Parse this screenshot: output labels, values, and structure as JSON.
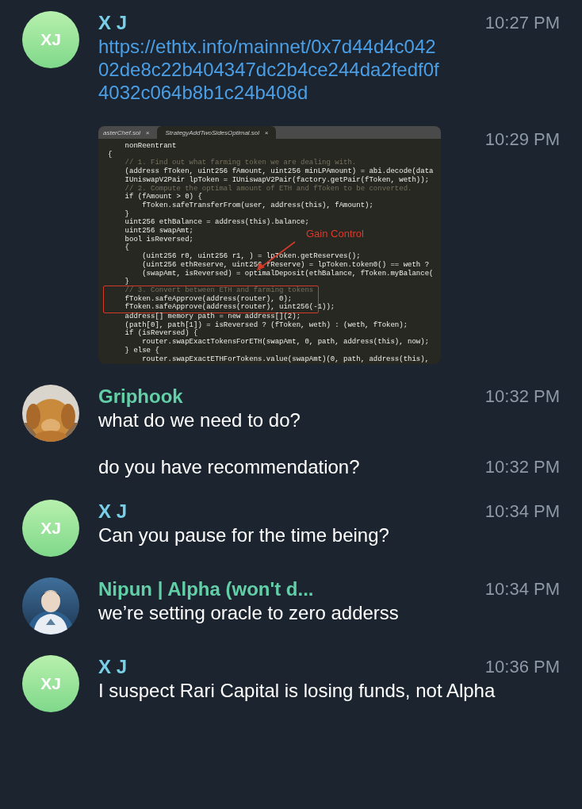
{
  "groups": [
    {
      "name": "X J",
      "color": "#78cfe6",
      "avatar": {
        "kind": "initials",
        "text": "XJ"
      },
      "messages": [
        {
          "kind": "link",
          "text": "https://ethtx.info/mainnet/0x7d44d4c04202de8c22b404347dc2b4ce244da2fedf0f4032c064b8b1c24b408d",
          "time": "10:27 PM"
        },
        {
          "time": "10:29 PM",
          "image": {
            "tabs": [
              {
                "label": "asterChef.sol",
                "close": "×",
                "selected": false
              },
              {
                "label": "StrategyAddTwoSidesOptimal.sol",
                "close": "×",
                "selected": true
              }
            ],
            "annotation": "Gain Control",
            "lines": [
              {
                "kind": "code",
                "text": "    nonReentrant",
                "highlighted": false
              },
              {
                "kind": "code",
                "text": "{",
                "highlighted": false
              },
              {
                "kind": "comment",
                "text": "    // 1. Find out what farming token we are dealing with.",
                "highlighted": false
              },
              {
                "kind": "code",
                "text": "    (address fToken, uint256 fAmount, uint256 minLPAmount) = abi.decode(data",
                "highlighted": false
              },
              {
                "kind": "code",
                "text": "    IUniswapV2Pair lpToken = IUniswapV2Pair(factory.getPair(fToken, weth));",
                "highlighted": false
              },
              {
                "kind": "comment",
                "text": "    // 2. Compute the optimal amount of ETH and fToken to be converted.",
                "highlighted": false
              },
              {
                "kind": "code",
                "text": "    if (fAmount > 0) {",
                "highlighted": false
              },
              {
                "kind": "code",
                "text": "        fToken.safeTransferFrom(user, address(this), fAmount);",
                "highlighted": false
              },
              {
                "kind": "code",
                "text": "    }",
                "highlighted": false
              },
              {
                "kind": "code",
                "text": "    uint256 ethBalance = address(this).balance;",
                "highlighted": false
              },
              {
                "kind": "code",
                "text": "    uint256 swapAmt;",
                "highlighted": false
              },
              {
                "kind": "code",
                "text": "    bool isReversed;",
                "highlighted": false
              },
              {
                "kind": "code",
                "text": "    {",
                "highlighted": false
              },
              {
                "kind": "code",
                "text": "        (uint256 r0, uint256 r1, ) = lpToken.getReserves();",
                "highlighted": false
              },
              {
                "kind": "code",
                "text": "        (uint256 ethReserve, uint256 fReserve) = lpToken.token0() == weth ?",
                "highlighted": false
              },
              {
                "kind": "code",
                "text": "        (swapAmt, isReversed) = optimalDeposit(ethBalance, fToken.myBalance(",
                "highlighted": false
              },
              {
                "kind": "code",
                "text": "    }",
                "highlighted": false
              },
              {
                "kind": "comment",
                "text": "    // 3. Convert between ETH and farming tokens",
                "highlighted": true
              },
              {
                "kind": "code",
                "text": "    fToken.safeApprove(address(router), 0);",
                "highlighted": true
              },
              {
                "kind": "code",
                "text": "    fToken.safeApprove(address(router), uint256(-1));",
                "highlighted": true
              },
              {
                "kind": "code",
                "text": "    address[] memory path = new address[](2);",
                "highlighted": false
              },
              {
                "kind": "code",
                "text": "    (path[0], path[1]) = isReversed ? (fToken, weth) : (weth, fToken);",
                "highlighted": false
              },
              {
                "kind": "code",
                "text": "    if (isReversed) {",
                "highlighted": false
              },
              {
                "kind": "code",
                "text": "        router.swapExactTokensForETH(swapAmt, 0, path, address(this), now);",
                "highlighted": false
              },
              {
                "kind": "code",
                "text": "    } else {",
                "highlighted": false
              },
              {
                "kind": "code",
                "text": "        router.swapExactETHForTokens.value(swapAmt)(0, path, address(this),",
                "highlighted": false
              }
            ]
          }
        }
      ]
    },
    {
      "name": "Griphook",
      "color": "#62cfa6",
      "avatar": {
        "kind": "picture"
      },
      "messages": [
        {
          "kind": "text",
          "text": "what do we need to do?",
          "time": "10:32 PM"
        },
        {
          "kind": "text",
          "text": "do you have recommendation?",
          "time": "10:32 PM"
        }
      ]
    },
    {
      "name": "X J",
      "color": "#78cfe6",
      "avatar": {
        "kind": "initials",
        "text": "XJ"
      },
      "messages": [
        {
          "kind": "text",
          "text": "Can you pause for the time being?",
          "time": "10:34 PM"
        }
      ]
    },
    {
      "name": "Nipun | Alpha (won't d...",
      "color": "#62cfa6",
      "avatar": {
        "kind": "picture"
      },
      "messages": [
        {
          "kind": "text",
          "text": "we’re setting oracle to zero adderss",
          "time": "10:34 PM"
        }
      ]
    },
    {
      "name": "X J",
      "color": "#78cfe6",
      "avatar": {
        "kind": "initials",
        "text": "XJ"
      },
      "messages": [
        {
          "kind": "text",
          "text": "I suspect Rari Capital is losing funds, not Alpha",
          "time": "10:36 PM"
        }
      ]
    }
  ]
}
